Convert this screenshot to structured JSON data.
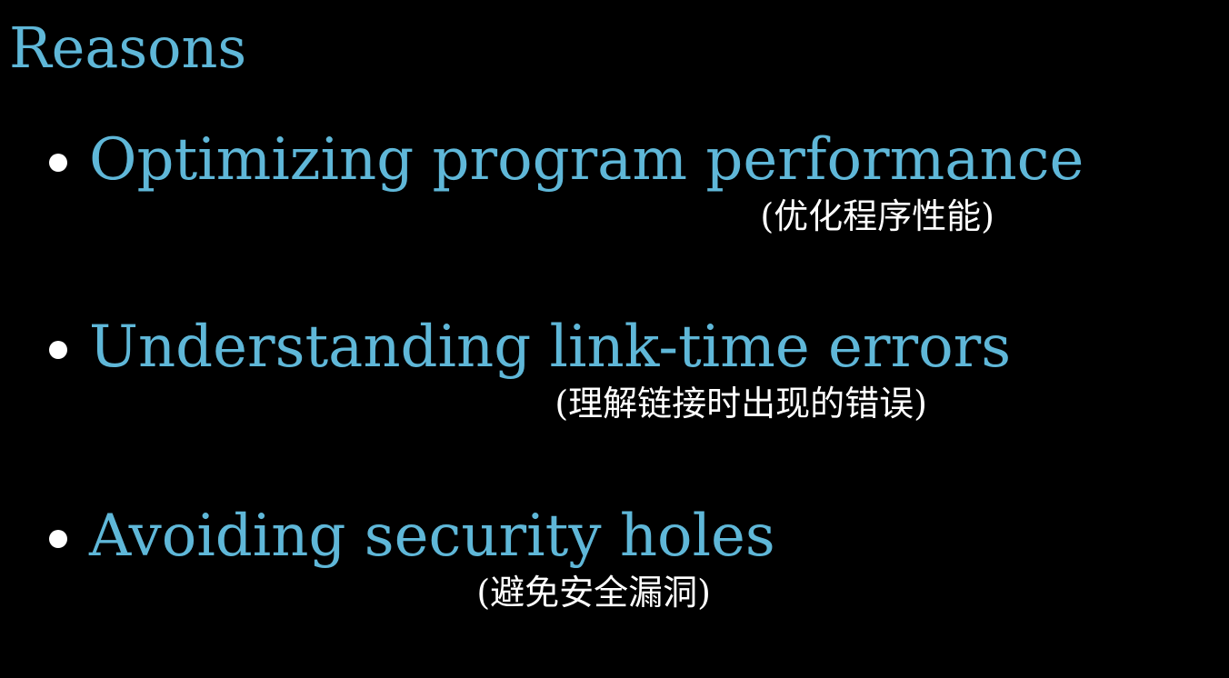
{
  "slide": {
    "title": "Reasons",
    "items": [
      {
        "text": "Optimizing program performance",
        "subtitle": "(优化程序性能)"
      },
      {
        "text": "Understanding link-time errors",
        "subtitle": "(理解链接时出现的错误)"
      },
      {
        "text": "Avoiding security holes",
        "subtitle": "(避免安全漏洞)"
      }
    ],
    "colors": {
      "background": "#000000",
      "heading": "#5fb7d8",
      "subtitle": "#ffffff",
      "bullet": "#ffffff"
    }
  }
}
